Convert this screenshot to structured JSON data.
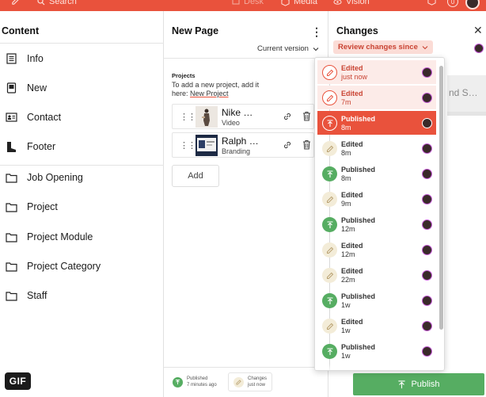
{
  "topbar": {
    "search_label": "Search",
    "desk_label": "Desk",
    "media_label": "Media",
    "vision_label": "Vision",
    "notification_count": "0"
  },
  "content": {
    "title": "Content",
    "items": [
      {
        "label": "Info",
        "icon": "document-list-icon"
      },
      {
        "label": "New",
        "icon": "document-icon"
      },
      {
        "label": "Contact",
        "icon": "contact-card-icon"
      },
      {
        "label": "Footer",
        "icon": "boot-icon"
      },
      {
        "label": "Job Opening",
        "icon": "folder-icon"
      },
      {
        "label": "Project",
        "icon": "folder-icon"
      },
      {
        "label": "Project Module",
        "icon": "folder-icon"
      },
      {
        "label": "Project Category",
        "icon": "folder-icon"
      },
      {
        "label": "Staff",
        "icon": "folder-icon"
      }
    ],
    "gif_badge": "GIF"
  },
  "page": {
    "title": "New Page",
    "version_label": "Current version",
    "projects_label": "Projects",
    "projects_help": "To add a new project, add it here: ",
    "projects_link": "New Project",
    "projects": [
      {
        "name": "Nike …",
        "type": "Video"
      },
      {
        "name": "Ralph …",
        "type": "Branding"
      }
    ],
    "add_label": "Add",
    "status_published_label": "Published",
    "status_published_time": "7 minutes ago",
    "status_changes_label": "Changes",
    "status_changes_time": "just now"
  },
  "changes": {
    "title": "Changes",
    "review_label": "Review changes since",
    "ghost_text": "nd S…",
    "publish_label": "Publish",
    "items": [
      {
        "label": "Edited",
        "time": "just now",
        "kind": "edited",
        "state": "highlight"
      },
      {
        "label": "Edited",
        "time": "7m",
        "kind": "edited",
        "state": "highlight"
      },
      {
        "label": "Published",
        "time": "8m",
        "kind": "published",
        "state": "selected"
      },
      {
        "label": "Edited",
        "time": "8m",
        "kind": "edited",
        "state": "normal"
      },
      {
        "label": "Published",
        "time": "8m",
        "kind": "published",
        "state": "normal"
      },
      {
        "label": "Edited",
        "time": "9m",
        "kind": "edited",
        "state": "normal"
      },
      {
        "label": "Published",
        "time": "12m",
        "kind": "published",
        "state": "normal"
      },
      {
        "label": "Edited",
        "time": "12m",
        "kind": "edited",
        "state": "normal"
      },
      {
        "label": "Edited",
        "time": "22m",
        "kind": "edited",
        "state": "normal"
      },
      {
        "label": "Published",
        "time": "1w",
        "kind": "published",
        "state": "normal"
      },
      {
        "label": "Edited",
        "time": "1w",
        "kind": "edited",
        "state": "normal"
      },
      {
        "label": "Published",
        "time": "1w",
        "kind": "published",
        "state": "normal"
      }
    ]
  },
  "colors": {
    "brand": "#e9523c",
    "publish_green": "#56ad62",
    "edit_amber": "#f3ecd8",
    "highlight": "#fcebe8"
  }
}
